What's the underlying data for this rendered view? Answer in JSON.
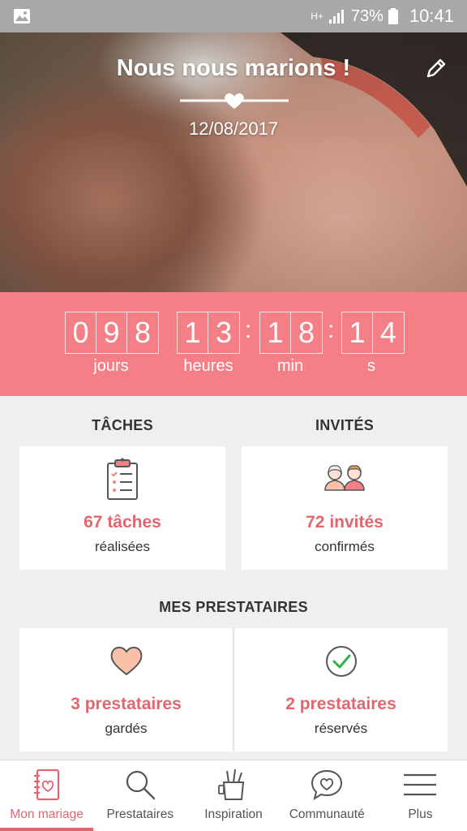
{
  "status_bar": {
    "network": "H+",
    "battery": "73%",
    "time": "10:41"
  },
  "hero": {
    "title": "Nous nous marions !",
    "date": "12/08/2017"
  },
  "countdown": {
    "days_digits": [
      "0",
      "9",
      "8"
    ],
    "hours_digits": [
      "1",
      "3"
    ],
    "minutes_digits": [
      "1",
      "8"
    ],
    "seconds_digits": [
      "1",
      "4"
    ],
    "separator": ":",
    "labels": {
      "days": "jours",
      "hours": "heures",
      "minutes": "min",
      "seconds": "s"
    }
  },
  "tasks": {
    "title": "TÂCHES",
    "value": "67 tâches",
    "sub": "réalisées"
  },
  "guests": {
    "title": "INVITÉS",
    "value": "72 invités",
    "sub": "confirmés"
  },
  "vendors": {
    "title": "MES PRESTATAIRES",
    "kept": {
      "value": "3 prestataires",
      "sub": "gardés"
    },
    "booked": {
      "value": "2 prestataires",
      "sub": "réservés"
    }
  },
  "nav": {
    "items": [
      {
        "label": "Mon mariage",
        "icon": "notebook-icon",
        "active": true
      },
      {
        "label": "Prestataires",
        "icon": "search-icon",
        "active": false
      },
      {
        "label": "Inspiration",
        "icon": "pencil-cup-icon",
        "active": false
      },
      {
        "label": "Communauté",
        "icon": "chat-heart-icon",
        "active": false
      },
      {
        "label": "Plus",
        "icon": "menu-icon",
        "active": false
      }
    ]
  },
  "colors": {
    "accent": "#f47f86",
    "accent_text": "#e0676f",
    "status_bar": "#a8a8a8"
  }
}
